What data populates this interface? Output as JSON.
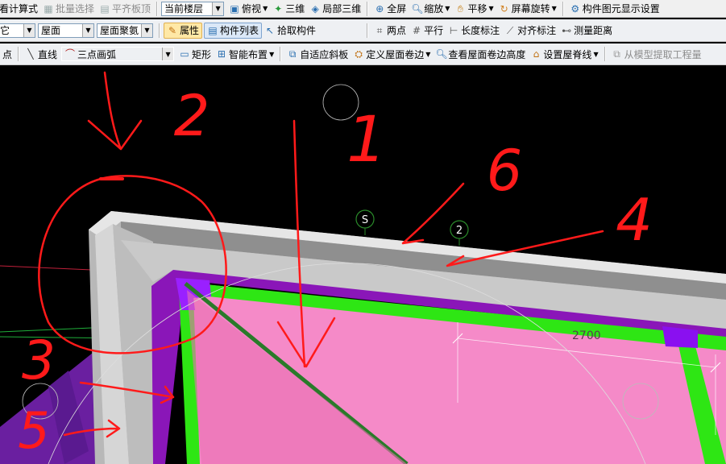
{
  "toolbar1": {
    "items": [
      {
        "label": "看计算式",
        "disabled": false
      },
      {
        "label": "批量选择",
        "disabled": true
      },
      {
        "label": "平齐板顶",
        "disabled": true
      }
    ],
    "floor_select": "当前楼层",
    "view_items": [
      {
        "label": "俯视",
        "dropdown": true
      },
      {
        "label": "三维",
        "dropdown": false
      },
      {
        "label": "局部三维",
        "dropdown": false
      }
    ],
    "screen_items": [
      {
        "label": "全屏",
        "dropdown": false
      },
      {
        "label": "缩放",
        "dropdown": true
      },
      {
        "label": "平移",
        "dropdown": true
      },
      {
        "label": "屏幕旋转",
        "dropdown": true
      },
      {
        "label": "构件图元显示设置",
        "dropdown": false
      }
    ]
  },
  "toolbar2": {
    "combo_type": "它",
    "combo_category": "屋面",
    "combo_component": "屋面聚氨",
    "property_button": "属性",
    "component_list_button": "构件列表",
    "pick_component": "拾取构件",
    "measure_items": [
      "两点",
      "平行",
      "长度标注",
      "对齐标注",
      "测量距离"
    ]
  },
  "toolbar3": {
    "point_label": "点",
    "line_label": "直线",
    "arc_combo": "三点画弧",
    "rect_label": "矩形",
    "smart_layout": "智能布置",
    "adaptive_slope": "自适应斜板",
    "define_roof_edge": "定义屋面卷边",
    "view_roof_edge_height": "查看屋面卷边高度",
    "set_roof_ridge": "设置屋脊线",
    "extract_from_model": "从模型提取工程量"
  },
  "viewport": {
    "dimension_label": "2700",
    "marker_s": "S",
    "marker_2": "2",
    "annotation_numbers": [
      "1",
      "2",
      "3",
      "4",
      "5",
      "6"
    ]
  },
  "colors": {
    "background": "#000000",
    "wall_gray": "#c8c8c8",
    "roof_pink": "#f58ac8",
    "beam_green": "#2ee614",
    "purple_edge": "#8a16b8",
    "annotation_red": "#ff1a1a"
  }
}
